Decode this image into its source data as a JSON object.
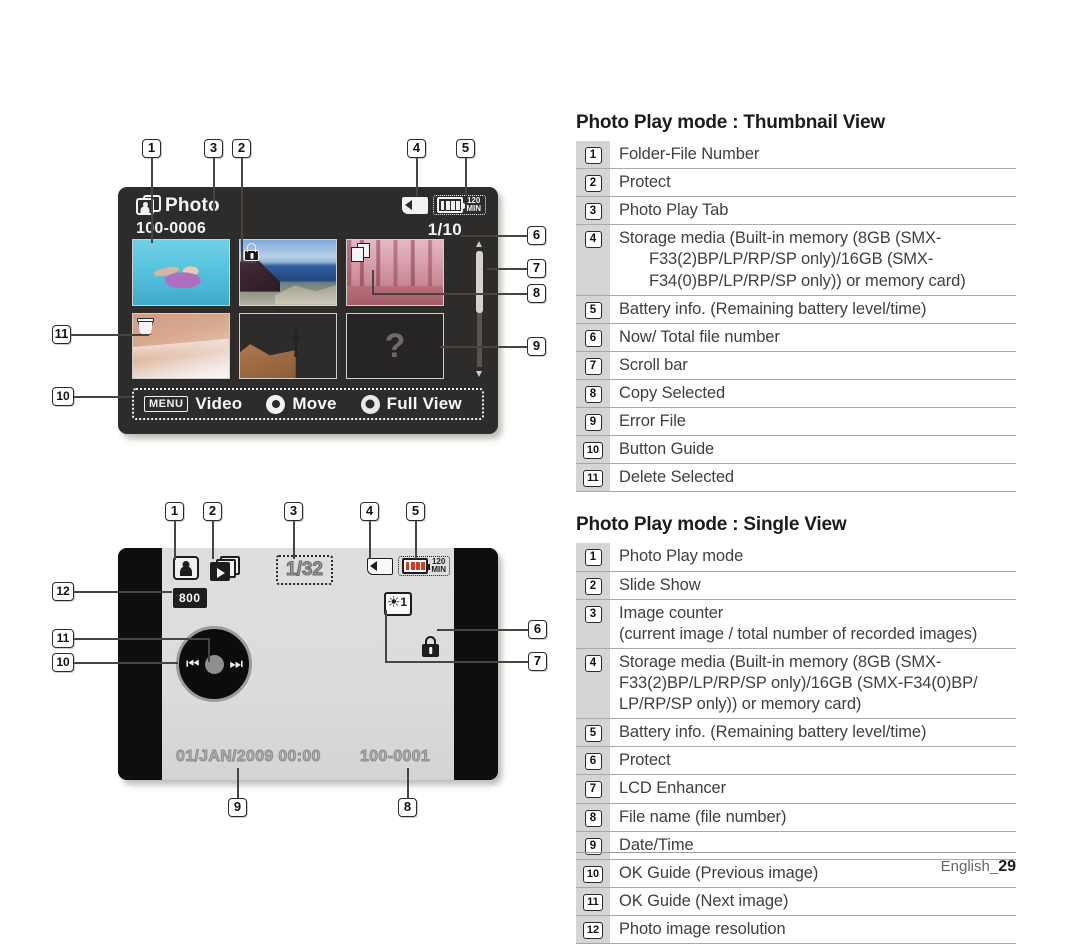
{
  "thumbnail_screen": {
    "tab_label": "Photo",
    "folder_file_number": "100-0006",
    "now_total": "1/10",
    "battery_time": "120",
    "battery_time_unit": "MIN",
    "thumbnails": [
      {
        "name": "pool-float-photo",
        "overlay": "none"
      },
      {
        "name": "lake-mountain-photo",
        "overlay": "protect-lock-icon"
      },
      {
        "name": "pink-forest-photo",
        "overlay": "copy-selected-icon"
      },
      {
        "name": "snow-dune-photo",
        "overlay": "delete-selected-trash-icon"
      },
      {
        "name": "desert-hiker-photo",
        "overlay": "none"
      },
      {
        "name": "error-file-thumbnail",
        "overlay": "question-mark",
        "error_glyph": "?"
      }
    ],
    "button_guide": {
      "menu_chip": "MENU",
      "menu_label": "Video",
      "move_label": "Move",
      "full_view_label": "Full View"
    }
  },
  "single_screen": {
    "image_counter": "1/32",
    "resolution": "800",
    "battery_time": "120",
    "battery_time_unit": "MIN",
    "lcd_enhancer_level": "1",
    "date_time": "01/JAN/2009 00:00",
    "file_name": "100-0001",
    "ok_prev_glyph": "⏮",
    "ok_next_glyph": "⏭"
  },
  "callouts": {
    "thumbnail": [
      "1",
      "2",
      "3",
      "4",
      "5",
      "6",
      "7",
      "8",
      "9",
      "10",
      "11"
    ],
    "single": [
      "1",
      "2",
      "3",
      "4",
      "5",
      "6",
      "7",
      "8",
      "9",
      "10",
      "11",
      "12"
    ]
  },
  "tables": [
    {
      "title": "Photo Play mode : Thumbnail View",
      "rows": [
        {
          "num": "1",
          "text": "Folder-File Number"
        },
        {
          "num": "2",
          "text": "Protect"
        },
        {
          "num": "3",
          "text": "Photo Play Tab"
        },
        {
          "num": "4",
          "text": "Storage media (Built-in memory (8GB (SMX-",
          "lines": [
            "F33(2)BP/LP/RP/SP only)/16GB (SMX-",
            "F34(0)BP/LP/RP/SP only)) or memory card)"
          ],
          "indent": true
        },
        {
          "num": "5",
          "text": "Battery info. (Remaining battery level/time)"
        },
        {
          "num": "6",
          "text": "Now/ Total file number"
        },
        {
          "num": "7",
          "text": "Scroll bar"
        },
        {
          "num": "8",
          "text": "Copy Selected"
        },
        {
          "num": "9",
          "text": "Error File"
        },
        {
          "num": "10",
          "text": "Button Guide"
        },
        {
          "num": "11",
          "text": "Delete Selected"
        }
      ]
    },
    {
      "title": "Photo Play mode : Single View",
      "rows": [
        {
          "num": "1",
          "text": "Photo Play mode"
        },
        {
          "num": "2",
          "text": "Slide Show"
        },
        {
          "num": "3",
          "text": "Image counter",
          "lines": [
            "(current image / total number of recorded images)"
          ],
          "indent": false
        },
        {
          "num": "4",
          "text": "Storage media (Built-in memory (8GB (SMX-",
          "lines": [
            "F33(2)BP/LP/RP/SP only)/16GB (SMX-F34(0)BP/",
            "LP/RP/SP only)) or memory card)"
          ],
          "indent": false
        },
        {
          "num": "5",
          "text": "Battery info. (Remaining battery level/time)"
        },
        {
          "num": "6",
          "text": "Protect"
        },
        {
          "num": "7",
          "text": "LCD Enhancer"
        },
        {
          "num": "8",
          "text": "File name (file number)"
        },
        {
          "num": "9",
          "text": "Date/Time"
        },
        {
          "num": "10",
          "text": "OK Guide (Previous image)"
        },
        {
          "num": "11",
          "text": "OK Guide (Next image)"
        },
        {
          "num": "12",
          "text": "Photo image resolution"
        }
      ]
    }
  ],
  "footer": {
    "language": "English_",
    "page": "29"
  }
}
